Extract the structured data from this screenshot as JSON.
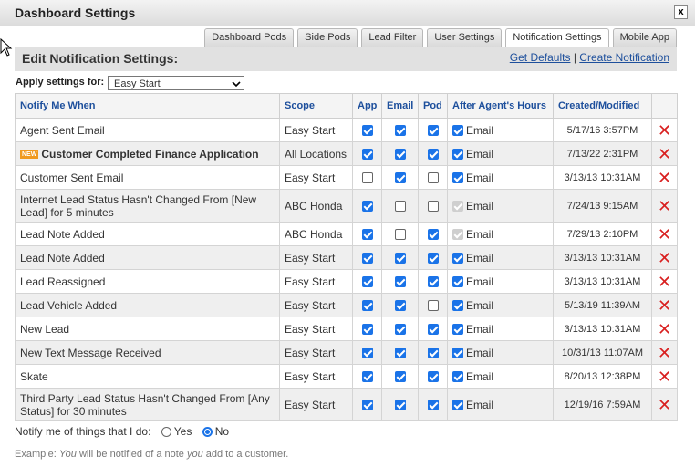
{
  "window": {
    "title": "Dashboard Settings",
    "close_label": "x"
  },
  "tabs": [
    {
      "label": "Dashboard Pods"
    },
    {
      "label": "Side Pods"
    },
    {
      "label": "Lead Filter"
    },
    {
      "label": "User Settings"
    },
    {
      "label": "Notification Settings",
      "active": true
    },
    {
      "label": "Mobile App"
    }
  ],
  "section": {
    "title": "Edit Notification Settings:",
    "get_defaults": "Get Defaults",
    "separator": "|",
    "create_notification": "Create Notification"
  },
  "apply": {
    "label": "Apply settings for:",
    "value": "Easy Start"
  },
  "columns": {
    "notify": "Notify Me When",
    "scope": "Scope",
    "app": "App",
    "email": "Email",
    "pod": "Pod",
    "after": "After Agent's Hours",
    "created": "Created/Modified"
  },
  "rows": [
    {
      "name": "Agent Sent Email",
      "scope": "Easy Start",
      "app": "on",
      "email": "on",
      "pod": "on",
      "after": "on",
      "after_label": "Email",
      "date": "5/17/16 3:57PM"
    },
    {
      "name": "Customer Completed Finance Application",
      "badge": "NEW",
      "bold": true,
      "scope": "All Locations",
      "app": "on",
      "email": "on",
      "pod": "on",
      "after": "on",
      "after_label": "Email",
      "date": "7/13/22 2:31PM"
    },
    {
      "name": "Customer Sent Email",
      "scope": "Easy Start",
      "app": "off",
      "email": "on",
      "pod": "off",
      "after": "on",
      "after_label": "Email",
      "date": "3/13/13 10:31AM"
    },
    {
      "name": "Internet Lead Status Hasn't Changed From [New Lead] for 5 minutes",
      "tall": true,
      "scope": "ABC Honda",
      "app": "on",
      "email": "off",
      "pod": "off",
      "after": "dis",
      "after_label": "Email",
      "date": "7/24/13 9:15AM"
    },
    {
      "name": "Lead Note Added",
      "scope": "ABC Honda",
      "app": "on",
      "email": "off",
      "pod": "on",
      "after": "dis",
      "after_label": "Email",
      "date": "7/29/13 2:10PM"
    },
    {
      "name": "Lead Note Added",
      "scope": "Easy Start",
      "app": "on",
      "email": "on",
      "pod": "on",
      "after": "on",
      "after_label": "Email",
      "date": "3/13/13 10:31AM"
    },
    {
      "name": "Lead Reassigned",
      "scope": "Easy Start",
      "app": "on",
      "email": "on",
      "pod": "on",
      "after": "on",
      "after_label": "Email",
      "date": "3/13/13 10:31AM"
    },
    {
      "name": "Lead Vehicle Added",
      "scope": "Easy Start",
      "app": "on",
      "email": "on",
      "pod": "off",
      "after": "on",
      "after_label": "Email",
      "date": "5/13/19 11:39AM"
    },
    {
      "name": "New Lead",
      "scope": "Easy Start",
      "app": "on",
      "email": "on",
      "pod": "on",
      "after": "on",
      "after_label": "Email",
      "date": "3/13/13 10:31AM"
    },
    {
      "name": "New Text Message Received",
      "scope": "Easy Start",
      "app": "on",
      "email": "on",
      "pod": "on",
      "after": "on",
      "after_label": "Email",
      "date": "10/31/13 11:07AM"
    },
    {
      "name": "Skate",
      "scope": "Easy Start",
      "app": "on",
      "email": "on",
      "pod": "on",
      "after": "on",
      "after_label": "Email",
      "date": "8/20/13 12:38PM"
    },
    {
      "name": "Third Party Lead Status Hasn't Changed From [Any Status] for 30 minutes",
      "tall": true,
      "scope": "Easy Start",
      "app": "on",
      "email": "on",
      "pod": "on",
      "after": "on",
      "after_label": "Email",
      "date": "12/19/16 7:59AM"
    }
  ],
  "delete_glyph": "✕",
  "notify_self": {
    "label": "Notify me of things that I do:",
    "yes": "Yes",
    "no": "No",
    "selected": "No"
  },
  "example": {
    "prefix": "Example: ",
    "you1": "You",
    "mid": " will be notified of a note ",
    "you2": "you",
    "suffix": " add to a customer."
  }
}
